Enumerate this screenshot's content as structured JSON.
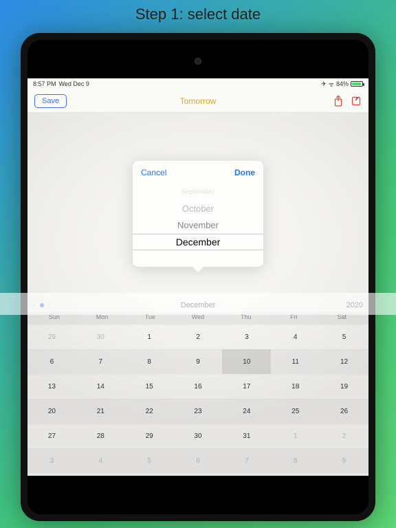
{
  "title": "Step 1: select date",
  "status": {
    "time": "8:57 PM",
    "date": "Wed Dec 9",
    "airplane": "✈︎",
    "wifi": "ᯤ",
    "battery_pct": "84%"
  },
  "nav": {
    "save": "Save",
    "title": "Tomorrow"
  },
  "popover": {
    "cancel": "Cancel",
    "done": "Done",
    "items": [
      "September",
      "October",
      "November",
      "December"
    ]
  },
  "month_nav": {
    "label": "December",
    "year": "2020",
    "chev_left": "‹",
    "chev_right": "›"
  },
  "weekdays": [
    "Sun",
    "Mon",
    "Tue",
    "Wed",
    "Thu",
    "Fri",
    "Sat"
  ],
  "calendar_rows": [
    {
      "alt": false,
      "cells": [
        {
          "d": "29",
          "dim": true
        },
        {
          "d": "30",
          "dim": true
        },
        {
          "d": "1"
        },
        {
          "d": "2"
        },
        {
          "d": "3"
        },
        {
          "d": "4"
        },
        {
          "d": "5"
        }
      ]
    },
    {
      "alt": true,
      "cells": [
        {
          "d": "6"
        },
        {
          "d": "7"
        },
        {
          "d": "8"
        },
        {
          "d": "9"
        },
        {
          "d": "10",
          "today": true
        },
        {
          "d": "11"
        },
        {
          "d": "12"
        }
      ]
    },
    {
      "alt": false,
      "cells": [
        {
          "d": "13"
        },
        {
          "d": "14"
        },
        {
          "d": "15"
        },
        {
          "d": "16"
        },
        {
          "d": "17"
        },
        {
          "d": "18"
        },
        {
          "d": "19"
        }
      ]
    },
    {
      "alt": true,
      "cells": [
        {
          "d": "20"
        },
        {
          "d": "21"
        },
        {
          "d": "22"
        },
        {
          "d": "23"
        },
        {
          "d": "24"
        },
        {
          "d": "25"
        },
        {
          "d": "26"
        }
      ]
    },
    {
      "alt": false,
      "cells": [
        {
          "d": "27"
        },
        {
          "d": "28"
        },
        {
          "d": "29"
        },
        {
          "d": "30"
        },
        {
          "d": "31"
        },
        {
          "d": "1",
          "dim": true
        },
        {
          "d": "2",
          "dim": true
        }
      ]
    },
    {
      "alt": true,
      "cells": [
        {
          "d": "3",
          "dim": true
        },
        {
          "d": "4",
          "dim": true
        },
        {
          "d": "5",
          "dim": true
        },
        {
          "d": "6",
          "dim": true
        },
        {
          "d": "7",
          "dim": true
        },
        {
          "d": "8",
          "dim": true
        },
        {
          "d": "9",
          "dim": true
        }
      ]
    }
  ]
}
